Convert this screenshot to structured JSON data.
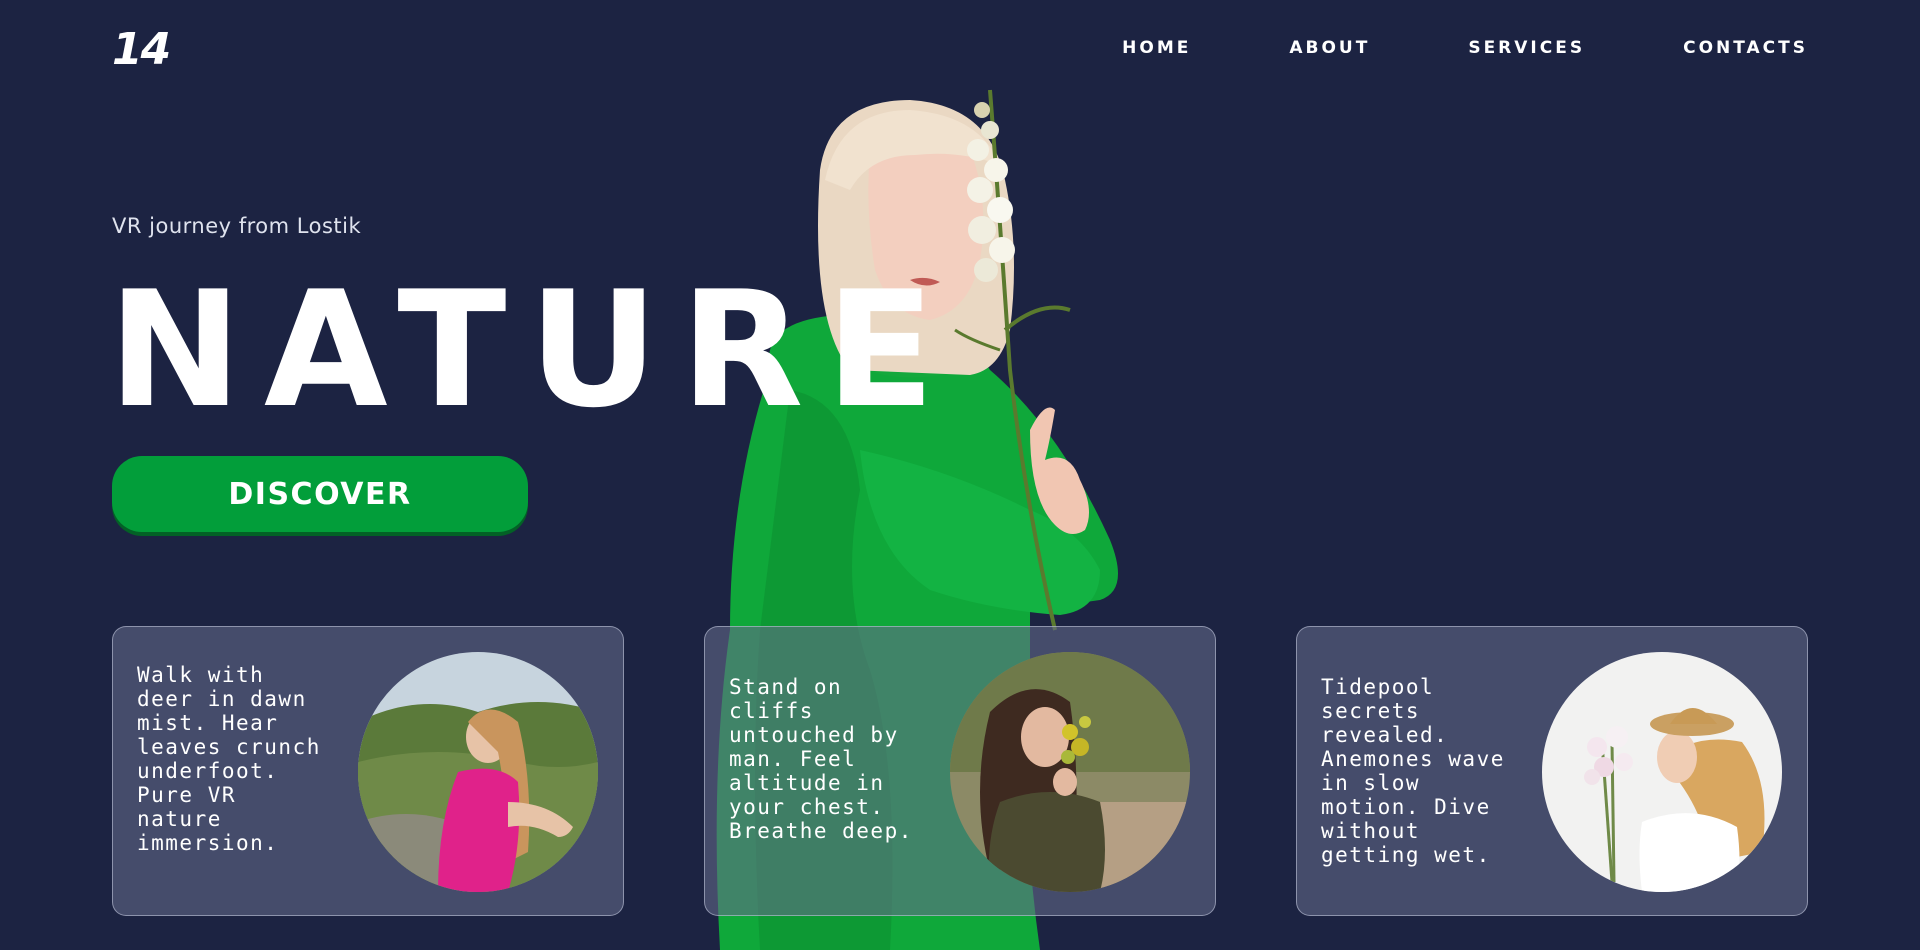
{
  "header": {
    "logo": "14",
    "nav": [
      "HOME",
      "ABOUT",
      "SERVICES",
      "CONTACTS"
    ]
  },
  "hero": {
    "subtitle": "VR journey from Lostik",
    "headline": "NATURE",
    "cta_label": "DISCOVER"
  },
  "cards": [
    {
      "text": "Walk with deer in dawn mist. Hear leaves crunch underfoot. Pure VR nature immersion."
    },
    {
      "text": "Stand on cliffs untouched by man. Feel altitude in your chest. Breathe deep."
    },
    {
      "text": "Tidepool secrets revealed. Anemones wave in slow motion. Dive without getting wet."
    }
  ],
  "colors": {
    "background": "#1c2342",
    "accent_green": "#029e3a",
    "card_bg": "#5a5f80"
  }
}
